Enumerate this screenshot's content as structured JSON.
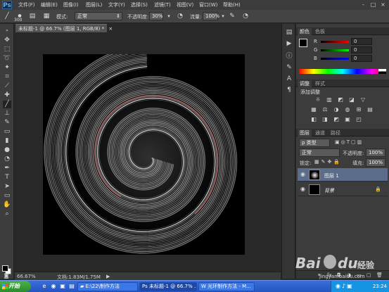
{
  "app": {
    "logo": "Ps"
  },
  "menubar": {
    "items": [
      "文件(F)",
      "编辑(E)",
      "图像(I)",
      "图层(L)",
      "文字(Y)",
      "选择(S)",
      "滤镜(T)",
      "视图(V)",
      "窗口(W)",
      "帮助(H)"
    ],
    "window_controls": [
      "-",
      "□",
      "×"
    ]
  },
  "options": {
    "brush_size": "300",
    "mode_label": "模式:",
    "mode_value": "正常",
    "opacity_label": "不透明度:",
    "opacity_value": "30%",
    "flow_label": "流量:",
    "flow_value": "100%"
  },
  "document": {
    "tab_title": "未标题-1 @ 66.7% (图层 1, RGB/8) *",
    "tab_close": "×"
  },
  "status": {
    "zoom": "66.67%",
    "doc_size": "文档:1.83M/1.75M"
  },
  "color_panel": {
    "tabs": [
      "颜色",
      "色板"
    ],
    "channels": [
      {
        "name": "R",
        "value": "0",
        "color": "#d33"
      },
      {
        "name": "G",
        "value": "0",
        "color": "#3c3"
      },
      {
        "name": "B",
        "value": "0",
        "color": "#36d"
      }
    ]
  },
  "adjust_panel": {
    "tabs": [
      "调整",
      "样式"
    ],
    "add_label": "添加调整",
    "icons_row1": [
      "☼",
      "▥",
      "◩",
      "◪",
      "▽"
    ],
    "icons_row2": [
      "▦",
      "⚖",
      "◑",
      "◍",
      "⊞",
      "▤"
    ],
    "icons_row3": [
      "◧",
      "◨",
      "◩",
      "▣",
      "◰"
    ]
  },
  "layers_panel": {
    "tabs": [
      "图层",
      "通道",
      "路径"
    ],
    "kind_label": "p 类型",
    "blend_mode": "正常",
    "opacity_label": "不透明度:",
    "opacity_value": "100%",
    "lock_label": "锁定:",
    "fill_label": "填充:",
    "fill_value": "100%",
    "layers": [
      {
        "name": "图层 1",
        "selected": true
      },
      {
        "name": "背景",
        "selected": false
      }
    ],
    "footer_icons": [
      "⚭",
      "fx",
      "◘",
      "◑",
      "▭",
      "▢",
      "🗑"
    ]
  },
  "taskbar": {
    "start_label": "开始",
    "quick_launch": [
      "e",
      "◉",
      "▣",
      "▤",
      "◈"
    ],
    "tasks": [
      {
        "label": "E:\\22\\制作方法",
        "active": false
      },
      {
        "label": "未标题-1 @ 66.7% ...",
        "active": true
      },
      {
        "label": "光环制作方法 - M...",
        "active": false
      }
    ],
    "clock": "23:24"
  },
  "watermark": {
    "brand": "Bai",
    "brand2": "du",
    "suffix": "经验",
    "url": "jingyan.baidu.com"
  }
}
